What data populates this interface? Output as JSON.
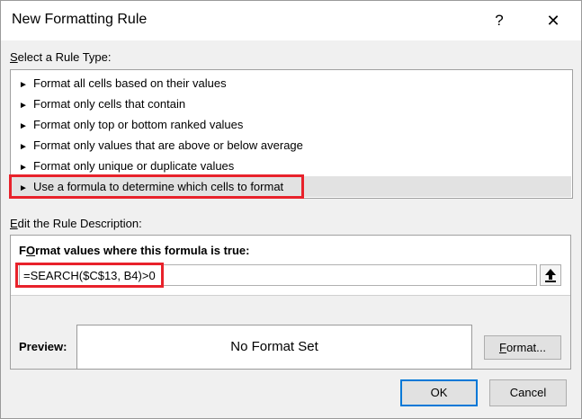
{
  "dialog": {
    "title": "New Formatting Rule",
    "help_glyph": "?",
    "close_glyph": "✕"
  },
  "rule_type": {
    "label_key": "S",
    "label_rest": "elect a Rule Type:",
    "items": [
      {
        "label": "Format all cells based on their values",
        "selected": false
      },
      {
        "label": "Format only cells that contain",
        "selected": false
      },
      {
        "label": "Format only top or bottom ranked values",
        "selected": false
      },
      {
        "label": "Format only values that are above or below average",
        "selected": false
      },
      {
        "label": "Format only unique or duplicate values",
        "selected": false
      },
      {
        "label": "Use a formula to determine which cells to format",
        "selected": true
      }
    ],
    "arrow_glyph": "►"
  },
  "description": {
    "label_key": "E",
    "label_rest": "dit the Rule Description:",
    "formula_caption_key": "O",
    "formula_caption_pre": "F",
    "formula_caption_rest": "rmat values where this formula is true:",
    "formula_value": "=SEARCH($C$13, B4)>0",
    "preview_label": "Preview:",
    "preview_text": "No Format Set",
    "format_button_key": "F",
    "format_button_rest": "ormat..."
  },
  "footer": {
    "ok_label": "OK",
    "cancel_label": "Cancel"
  },
  "colors": {
    "highlight": "#e8222b",
    "selected_row": "#e2e2e2",
    "default_button_border": "#0078d7"
  }
}
